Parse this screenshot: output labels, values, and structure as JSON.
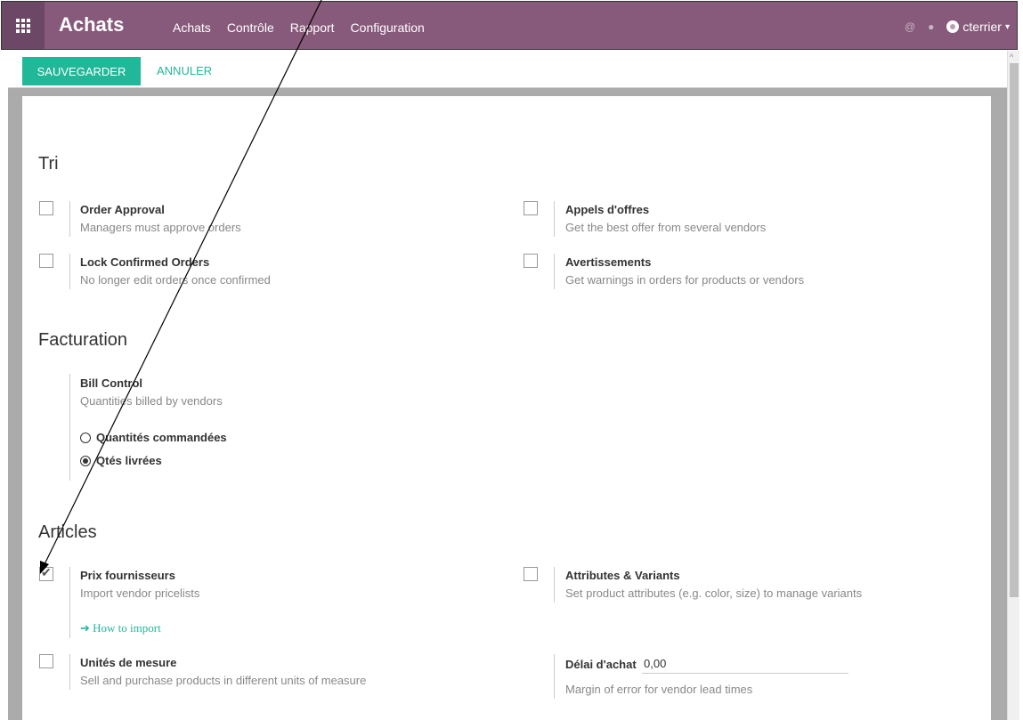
{
  "topbar": {
    "app_title": "Achats",
    "menu": [
      "Achats",
      "Contrôle",
      "Rapport",
      "Configuration"
    ],
    "at_icon": "@",
    "chat_icon": "●",
    "user": "cterrier",
    "caret": "▾"
  },
  "controls": {
    "save": "SAUVEGARDER",
    "cancel": "ANNULER"
  },
  "sections": {
    "tri": {
      "title": "Tri",
      "order_approval": {
        "title": "Order Approval",
        "desc": "Managers must approve orders",
        "checked": false
      },
      "appels_offres": {
        "title": "Appels d'offres",
        "desc": "Get the best offer from several vendors",
        "checked": false
      },
      "lock_orders": {
        "title": "Lock Confirmed Orders",
        "desc": "No longer edit orders once confirmed",
        "checked": false
      },
      "avertissements": {
        "title": "Avertissements",
        "desc": "Get warnings in orders for products or vendors",
        "checked": false
      }
    },
    "facturation": {
      "title": "Facturation",
      "bill_control": {
        "title": "Bill Control",
        "desc": "Quantities billed by vendors"
      },
      "options": [
        {
          "label": "Quantités commandées",
          "selected": false
        },
        {
          "label": "Qtés livrées",
          "selected": true
        }
      ]
    },
    "articles": {
      "title": "Articles",
      "prix_fournisseurs": {
        "title": "Prix fournisseurs",
        "desc": "Import vendor pricelists",
        "checked": true,
        "link": "How to import",
        "link_arrow": "➔"
      },
      "attributes": {
        "title": "Attributes & Variants",
        "desc": "Set product attributes (e.g. color, size) to manage variants",
        "checked": false
      },
      "unites": {
        "title": "Unités de mesure",
        "desc": "Sell and purchase products in different units of measure",
        "checked": false
      },
      "delai": {
        "label": "Délai d'achat",
        "value": "0,00",
        "desc": "Margin of error for vendor lead times"
      }
    }
  }
}
